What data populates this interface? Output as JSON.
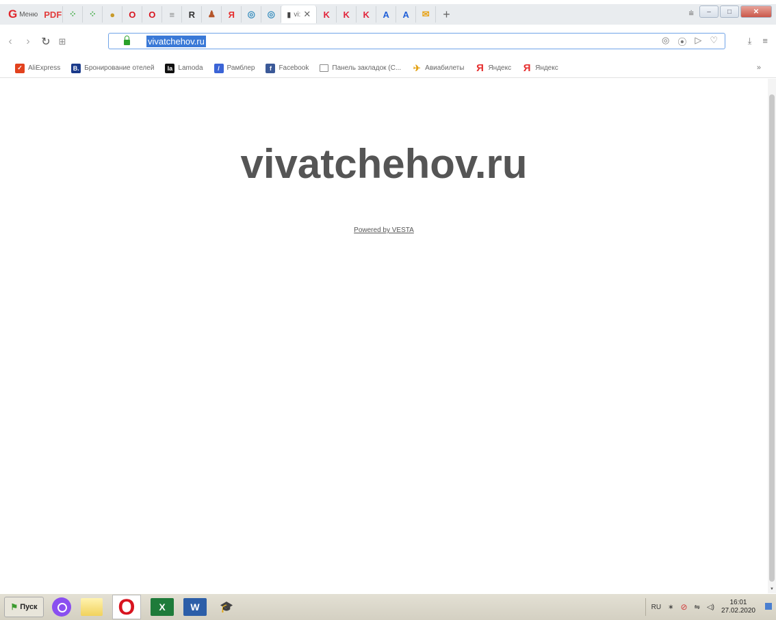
{
  "browser": {
    "menu_label": "Меню",
    "tabs": [
      {
        "icon": "pdf-icon",
        "label": "PDF",
        "color": "#e23c3c"
      },
      {
        "icon": "apps-icon",
        "label": "⁘",
        "color": "#4caf50"
      },
      {
        "icon": "apps-icon",
        "label": "⁘",
        "color": "#4caf50"
      },
      {
        "icon": "cake-icon",
        "label": "●",
        "color": "#c89b2b"
      },
      {
        "icon": "opera-icon",
        "label": "O",
        "color": "#d8141f"
      },
      {
        "icon": "opera-icon",
        "label": "O",
        "color": "#d8141f"
      },
      {
        "icon": "menu-icon",
        "label": "≡",
        "color": "#888888"
      },
      {
        "icon": "r-icon",
        "label": "R",
        "color": "#333333"
      },
      {
        "icon": "person-icon",
        "label": "♟",
        "color": "#b5552a"
      },
      {
        "icon": "yandex-icon",
        "label": "Я",
        "color": "#e62e2e"
      },
      {
        "icon": "globe-icon",
        "label": "◎",
        "color": "#3a8fbf"
      },
      {
        "icon": "globe-icon",
        "label": "◎",
        "color": "#3a8fbf"
      }
    ],
    "active_tab": {
      "label": "vi:"
    },
    "tabs_after": [
      {
        "icon": "k-icon",
        "label": "K",
        "color": "#e2243b"
      },
      {
        "icon": "k-icon",
        "label": "K",
        "color": "#e2243b"
      },
      {
        "icon": "k-icon",
        "label": "K",
        "color": "#e2243b"
      },
      {
        "icon": "a-icon",
        "label": "A",
        "color": "#1f5fd8"
      },
      {
        "icon": "a-icon",
        "label": "A",
        "color": "#1f5fd8"
      },
      {
        "icon": "mail-icon",
        "label": "✉",
        "color": "#e8a317"
      }
    ],
    "url": "vivatchehov.ru",
    "bookmarks": [
      {
        "label": "AliExpress",
        "icon": "aliexpress-icon",
        "icon_text": "✓",
        "bg": "#e2421e",
        "kind": "box"
      },
      {
        "label": "Бронирование отелей",
        "icon": "booking-icon",
        "icon_text": "B.",
        "bg": "#1a3a8a",
        "kind": "box"
      },
      {
        "label": "Lamoda",
        "icon": "lamoda-icon",
        "icon_text": "la",
        "bg": "#111111",
        "kind": "box"
      },
      {
        "label": "Рамблер",
        "icon": "rambler-icon",
        "icon_text": "/",
        "bg": "#3b64d6",
        "kind": "box"
      },
      {
        "label": "Facebook",
        "icon": "facebook-icon",
        "icon_text": "f",
        "bg": "#3b5998",
        "kind": "box"
      },
      {
        "label": "Панель закладок (C...",
        "icon": "folder-icon",
        "icon_text": "",
        "bg": "",
        "kind": "plain"
      },
      {
        "label": "Авиабилеты",
        "icon": "plane-icon",
        "icon_text": "✈",
        "bg": "",
        "kind": "plane"
      },
      {
        "label": "Яндекс",
        "icon": "yandex-icon",
        "icon_text": "Я",
        "bg": "",
        "kind": "ya"
      },
      {
        "label": "Яндекс",
        "icon": "yandex-icon",
        "icon_text": "Я",
        "bg": "",
        "kind": "ya"
      }
    ]
  },
  "page": {
    "title": "vivatchehov.ru",
    "powered_by": "Powered by VESTA"
  },
  "taskbar": {
    "start_label": "Пуск",
    "lang": "RU",
    "time": "16:01",
    "date": "27.02.2020"
  }
}
